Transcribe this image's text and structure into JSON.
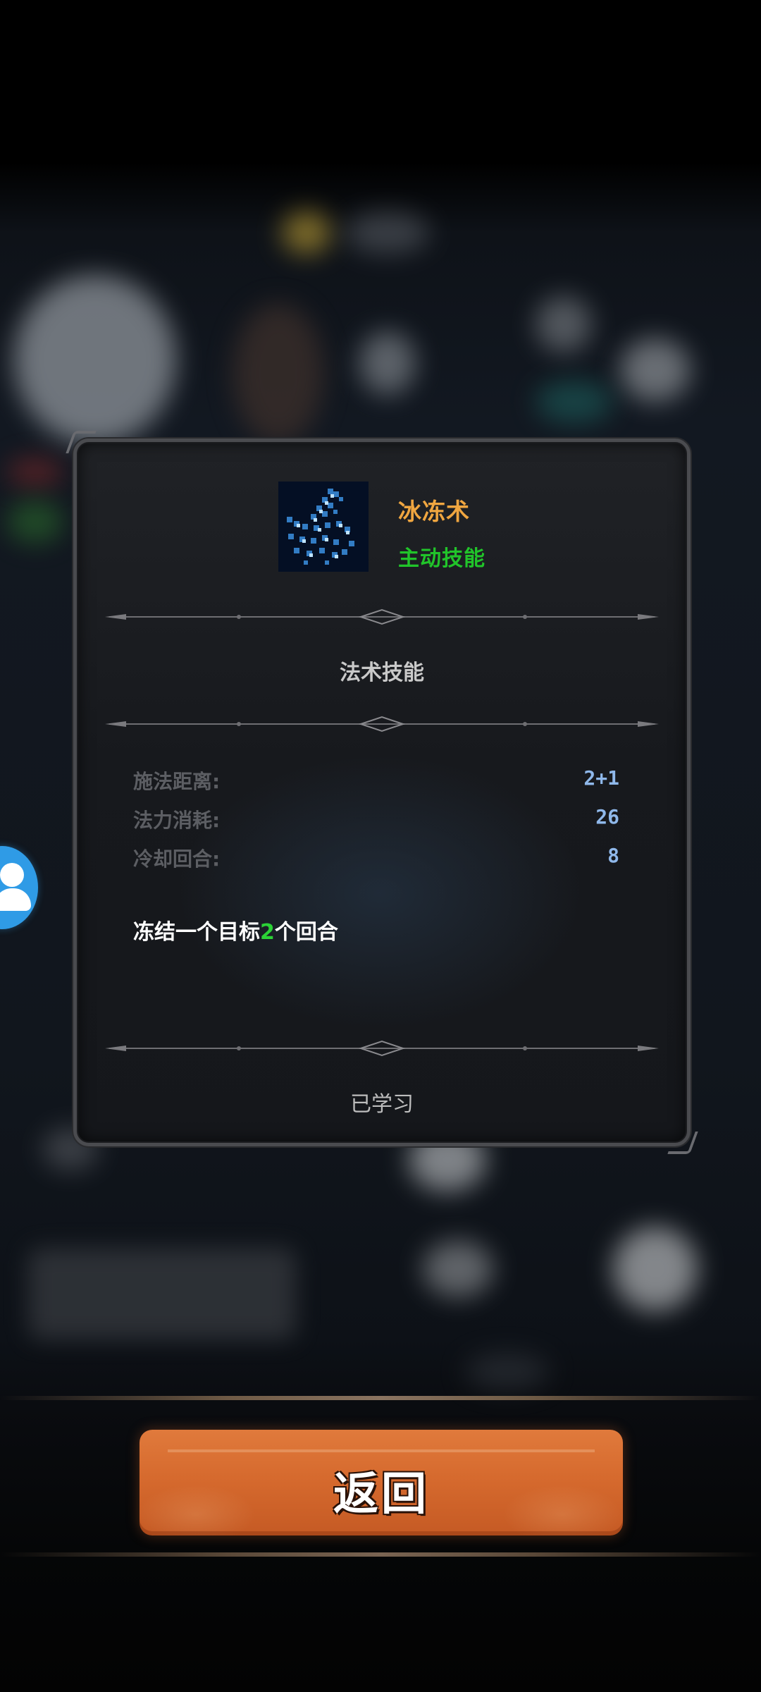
{
  "skill": {
    "name": "冰冻术",
    "type": "主动技能",
    "icon": "ice-freeze-skill-icon",
    "category": "法术技能",
    "stats": [
      {
        "label": "施法距离:",
        "value": "2+1"
      },
      {
        "label": "法力消耗:",
        "value": "26"
      },
      {
        "label": "冷却回合:",
        "value": "8"
      }
    ],
    "description": {
      "prefix": "冻结一个目标",
      "highlight": "2",
      "suffix": "个回合"
    },
    "status": "已学习"
  },
  "footer": {
    "return_label": "返回"
  },
  "colors": {
    "skill_name": "#f0a640",
    "skill_type": "#21c42a",
    "stat_value": "#8fb8ea",
    "highlight": "#2bd236",
    "button": "#d66a2e"
  }
}
